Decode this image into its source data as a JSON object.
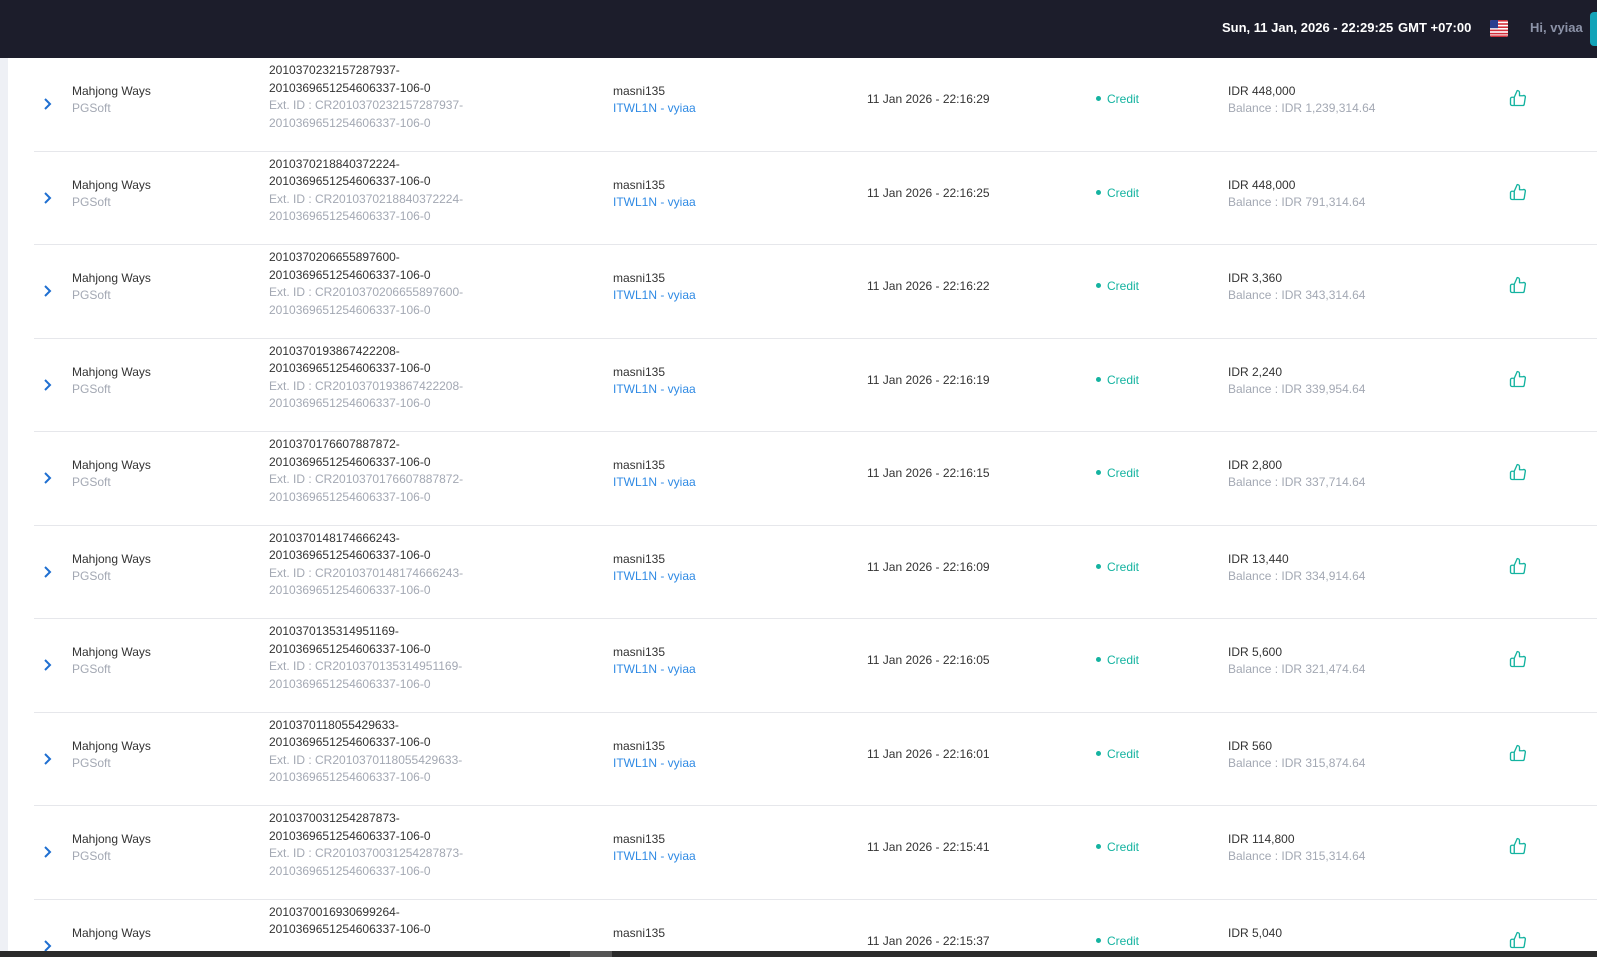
{
  "header": {
    "clock": "Sun, 11 Jan, 2026 - 22:29:25",
    "timezone": "GMT +07:00",
    "greeting": "Hi, vyiaa",
    "flag_icon": "us-flag-icon"
  },
  "colors": {
    "topbar_bg": "#1c1d2b",
    "credit_green": "#14b3a0",
    "agent_link_blue": "#2f8ae4",
    "muted_text": "#a3a8b3"
  },
  "rows": [
    {
      "game": "Mahjong Ways",
      "provider": "PGSoft",
      "tx_line1": "2010370232157287937-",
      "tx_line2": "2010369651254606337-106-0",
      "ext_line1": "Ext. ID : CR2010370232157287937-",
      "ext_line2": "2010369651254606337-106-0",
      "username": "masni135",
      "agent": "ITWL1N - vyiaa",
      "time": "11 Jan 2026 - 22:16:29",
      "status": "Credit",
      "amount": "IDR 448,000",
      "balance": "Balance : IDR 1,239,314.64"
    },
    {
      "game": "Mahjong Ways",
      "provider": "PGSoft",
      "tx_line1": "2010370218840372224-",
      "tx_line2": "2010369651254606337-106-0",
      "ext_line1": "Ext. ID : CR2010370218840372224-",
      "ext_line2": "2010369651254606337-106-0",
      "username": "masni135",
      "agent": "ITWL1N - vyiaa",
      "time": "11 Jan 2026 - 22:16:25",
      "status": "Credit",
      "amount": "IDR 448,000",
      "balance": "Balance : IDR 791,314.64"
    },
    {
      "game": "Mahjong Ways",
      "provider": "PGSoft",
      "tx_line1": "2010370206655897600-",
      "tx_line2": "2010369651254606337-106-0",
      "ext_line1": "Ext. ID : CR2010370206655897600-",
      "ext_line2": "2010369651254606337-106-0",
      "username": "masni135",
      "agent": "ITWL1N - vyiaa",
      "time": "11 Jan 2026 - 22:16:22",
      "status": "Credit",
      "amount": "IDR 3,360",
      "balance": "Balance : IDR 343,314.64"
    },
    {
      "game": "Mahjong Ways",
      "provider": "PGSoft",
      "tx_line1": "2010370193867422208-",
      "tx_line2": "2010369651254606337-106-0",
      "ext_line1": "Ext. ID : CR2010370193867422208-",
      "ext_line2": "2010369651254606337-106-0",
      "username": "masni135",
      "agent": "ITWL1N - vyiaa",
      "time": "11 Jan 2026 - 22:16:19",
      "status": "Credit",
      "amount": "IDR 2,240",
      "balance": "Balance : IDR 339,954.64"
    },
    {
      "game": "Mahjong Ways",
      "provider": "PGSoft",
      "tx_line1": "2010370176607887872-",
      "tx_line2": "2010369651254606337-106-0",
      "ext_line1": "Ext. ID : CR2010370176607887872-",
      "ext_line2": "2010369651254606337-106-0",
      "username": "masni135",
      "agent": "ITWL1N - vyiaa",
      "time": "11 Jan 2026 - 22:16:15",
      "status": "Credit",
      "amount": "IDR 2,800",
      "balance": "Balance : IDR 337,714.64"
    },
    {
      "game": "Mahjong Ways",
      "provider": "PGSoft",
      "tx_line1": "2010370148174666243-",
      "tx_line2": "2010369651254606337-106-0",
      "ext_line1": "Ext. ID : CR2010370148174666243-",
      "ext_line2": "2010369651254606337-106-0",
      "username": "masni135",
      "agent": "ITWL1N - vyiaa",
      "time": "11 Jan 2026 - 22:16:09",
      "status": "Credit",
      "amount": "IDR 13,440",
      "balance": "Balance : IDR 334,914.64"
    },
    {
      "game": "Mahjong Ways",
      "provider": "PGSoft",
      "tx_line1": "2010370135314951169-",
      "tx_line2": "2010369651254606337-106-0",
      "ext_line1": "Ext. ID : CR2010370135314951169-",
      "ext_line2": "2010369651254606337-106-0",
      "username": "masni135",
      "agent": "ITWL1N - vyiaa",
      "time": "11 Jan 2026 - 22:16:05",
      "status": "Credit",
      "amount": "IDR 5,600",
      "balance": "Balance : IDR 321,474.64"
    },
    {
      "game": "Mahjong Ways",
      "provider": "PGSoft",
      "tx_line1": "2010370118055429633-",
      "tx_line2": "2010369651254606337-106-0",
      "ext_line1": "Ext. ID : CR2010370118055429633-",
      "ext_line2": "2010369651254606337-106-0",
      "username": "masni135",
      "agent": "ITWL1N - vyiaa",
      "time": "11 Jan 2026 - 22:16:01",
      "status": "Credit",
      "amount": "IDR 560",
      "balance": "Balance : IDR 315,874.64"
    },
    {
      "game": "Mahjong Ways",
      "provider": "PGSoft",
      "tx_line1": "2010370031254287873-",
      "tx_line2": "2010369651254606337-106-0",
      "ext_line1": "Ext. ID : CR2010370031254287873-",
      "ext_line2": "2010369651254606337-106-0",
      "username": "masni135",
      "agent": "ITWL1N - vyiaa",
      "time": "11 Jan 2026 - 22:15:41",
      "status": "Credit",
      "amount": "IDR 114,800",
      "balance": "Balance : IDR 315,314.64"
    },
    {
      "game": "Mahjong Ways",
      "provider": "",
      "tx_line1": "2010370016930699264-",
      "tx_line2": "2010369651254606337-106-0",
      "ext_line1": "",
      "ext_line2": "",
      "username": "masni135",
      "agent": "",
      "time": "11 Jan 2026 - 22:15:37",
      "status": "Credit",
      "amount": "IDR 5,040",
      "balance": ""
    }
  ]
}
